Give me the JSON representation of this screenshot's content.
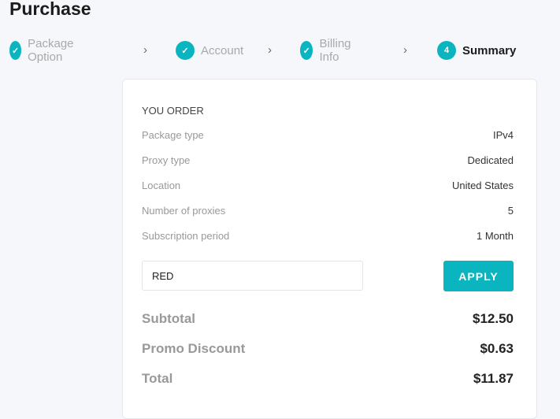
{
  "title": "Purchase",
  "steps": [
    {
      "label": "Package Option",
      "state": "done"
    },
    {
      "label": "Account",
      "state": "done"
    },
    {
      "label": "Billing Info",
      "state": "done"
    },
    {
      "label": "Summary",
      "number": "4",
      "state": "active"
    }
  ],
  "accent": "#0ab5bf",
  "order": {
    "heading": "YOU ORDER",
    "rows": [
      {
        "k": "Package type",
        "v": "IPv4"
      },
      {
        "k": "Proxy type",
        "v": "Dedicated"
      },
      {
        "k": "Location",
        "v": "United States"
      },
      {
        "k": "Number of proxies",
        "v": "5"
      },
      {
        "k": "Subscription period",
        "v": "1 Month"
      }
    ],
    "promo_value": "RED",
    "apply_label": "APPLY",
    "totals": [
      {
        "k": "Subtotal",
        "v": "$12.50"
      },
      {
        "k": "Promo Discount",
        "v": "$0.63"
      },
      {
        "k": "Total",
        "v": "$11.87"
      }
    ]
  }
}
